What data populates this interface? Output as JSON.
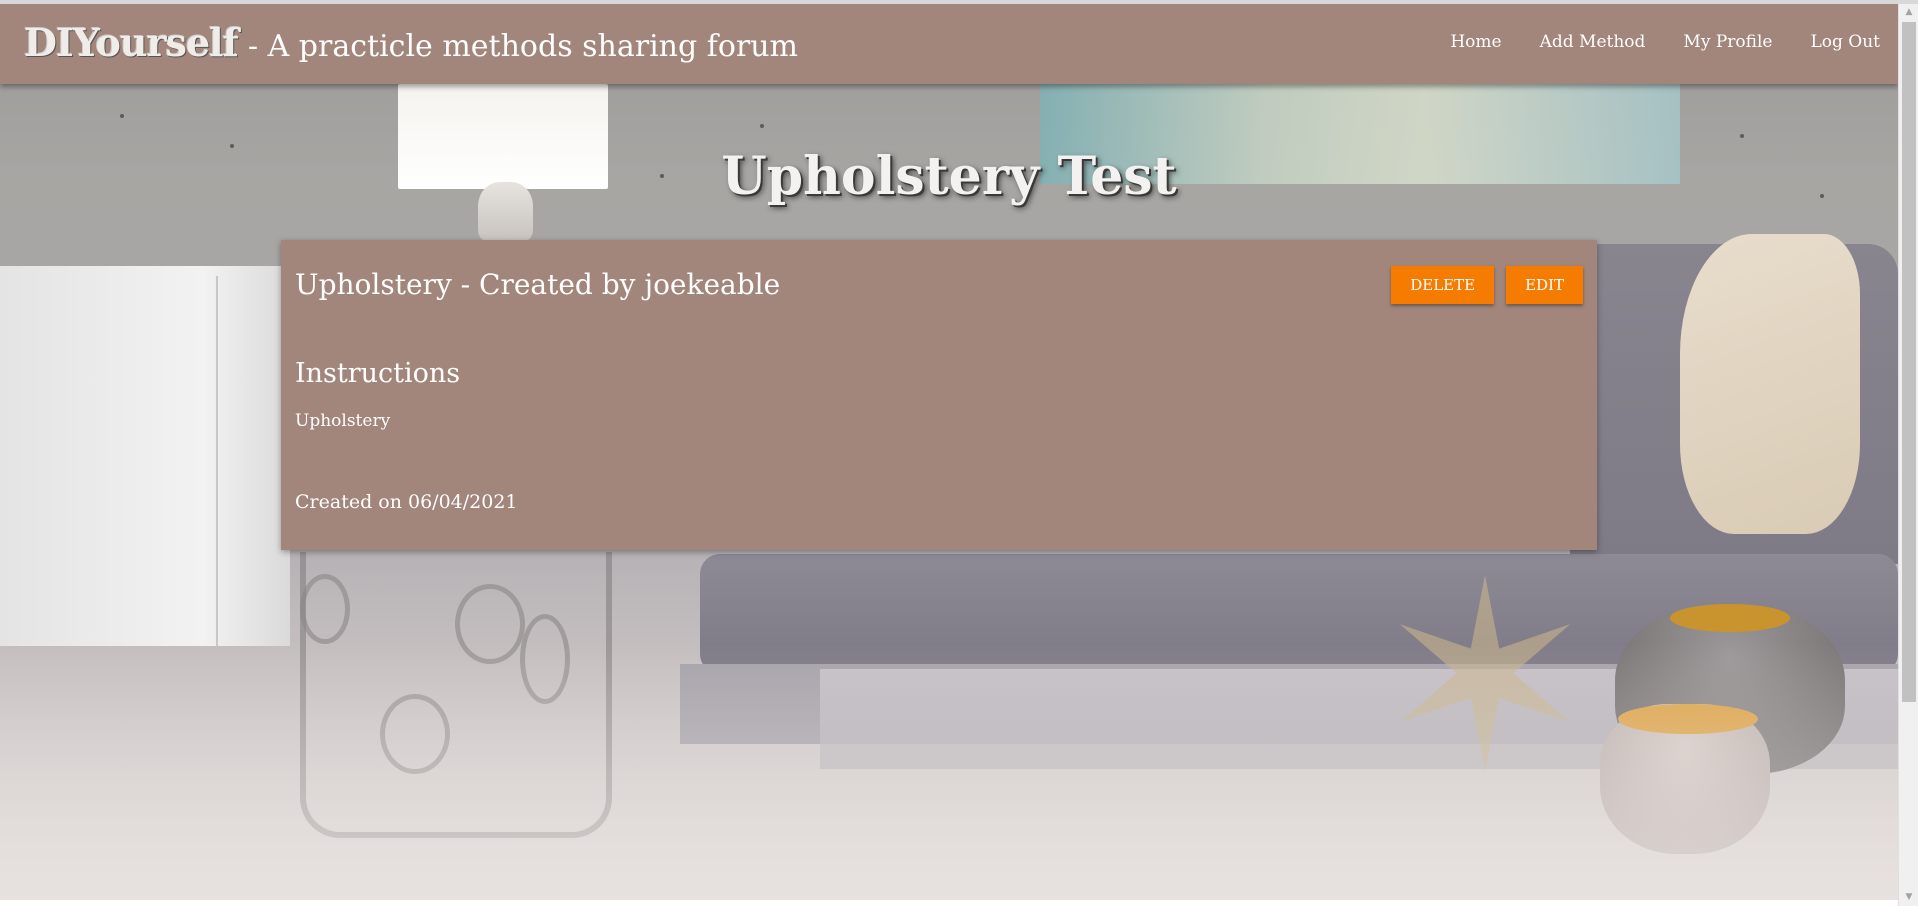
{
  "navbar": {
    "brand_name": "DIYourself",
    "brand_tagline": "- A practicle methods sharing forum",
    "links": [
      {
        "label": "Home"
      },
      {
        "label": "Add Method"
      },
      {
        "label": "My Profile"
      },
      {
        "label": "Log Out"
      }
    ]
  },
  "page": {
    "heading": "Upholstery Test"
  },
  "method_card": {
    "title": "Upholstery - Created by joekeable",
    "delete_label": "DELETE",
    "edit_label": "EDIT",
    "instructions_heading": "Instructions",
    "instructions_text": "Upholstery",
    "created_on": "Created on 06/04/2021"
  },
  "colors": {
    "navbar_bg": "#a2857b",
    "card_bg": "#a2857b",
    "button_bg": "#f57c00",
    "text": "#ffffff"
  },
  "icons": {
    "scroll_up": "triangle-up-icon",
    "scroll_down": "triangle-down-icon"
  }
}
